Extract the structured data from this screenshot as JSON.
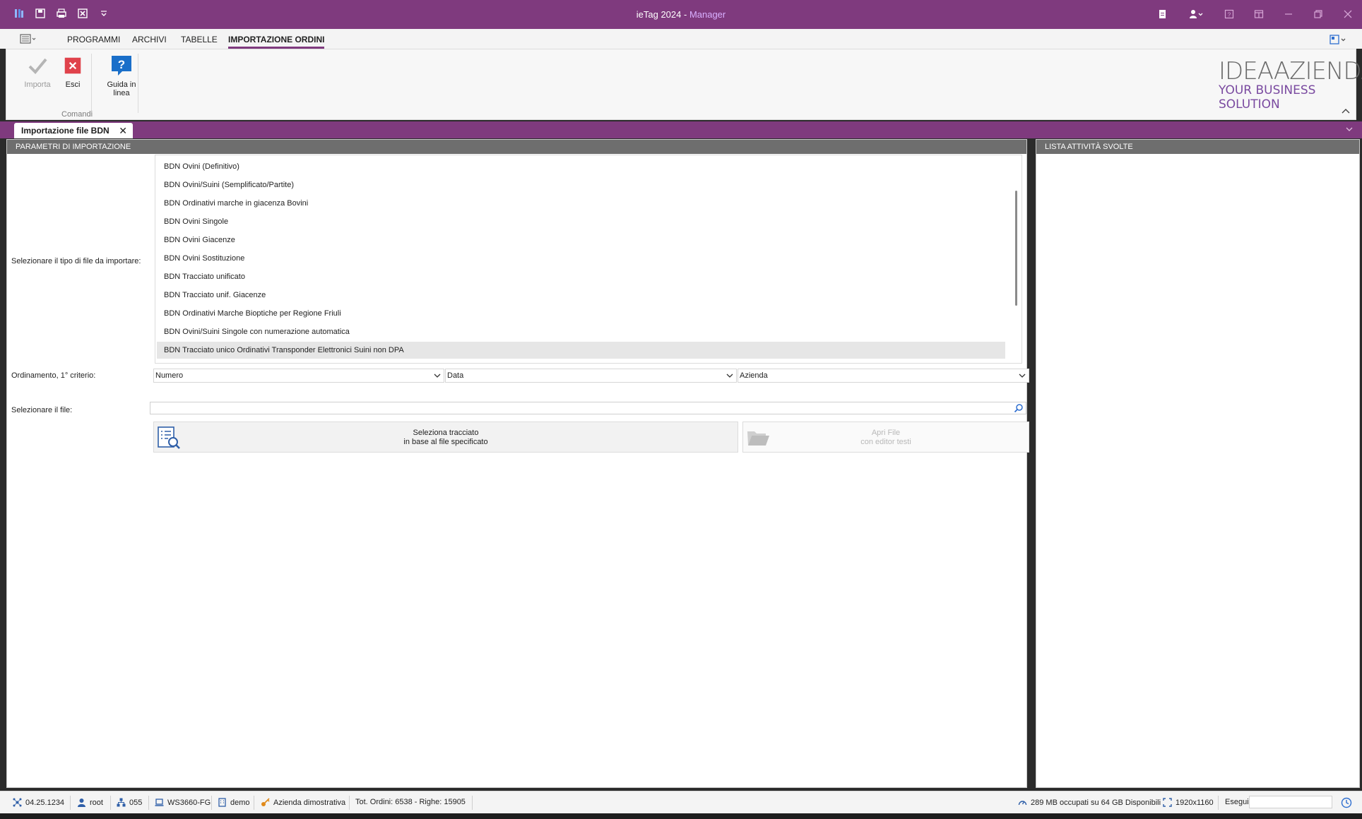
{
  "window": {
    "title_app": "ieTag 2024",
    "title_sep": " - ",
    "title_role": "Manager"
  },
  "ribbon_tabs": [
    "PROGRAMMI",
    "ARCHIVI",
    "TABELLE",
    "IMPORTAZIONE ORDINI"
  ],
  "ribbon": {
    "import_label": "Importa",
    "exit_label": "Esci",
    "help_label_1": "Guida in",
    "help_label_2": "linea",
    "group_label": "Comandi",
    "logo_line1": "IDEAAZIENDA",
    "logo_line2": "YOUR BUSINESS SOLUTION"
  },
  "doc_tab": {
    "label": "Importazione file BDN",
    "close": "✕"
  },
  "left_panel": {
    "header": "PARAMETRI DI IMPORTAZIONE",
    "file_type_label": "Selezionare il tipo di file da importare:",
    "file_types": [
      "BDN Ovini (Definitivo)",
      "BDN Ovini/Suini (Semplificato/Partite)",
      "BDN Ordinativi marche in giacenza Bovini",
      "BDN Ovini Singole",
      "BDN Ovini Giacenze",
      "BDN Ovini Sostituzione",
      "BDN Tracciato unificato",
      "BDN Tracciato unif. Giacenze",
      "BDN Ordinativi Marche Bioptiche per Regione Friuli",
      "BDN Ovini/Suini Singole con numerazione automatica",
      "BDN Tracciato unico Ordinativi Transponder Elettronici Suini non DPA"
    ],
    "selected_index": 10,
    "sort_label": "Ordinamento, 1° criterio:",
    "sort_values": [
      "Numero",
      "Data",
      "Azienda"
    ],
    "file_label": "Selezionare il file:",
    "file_value": "",
    "btn_select_1": "Seleziona tracciato",
    "btn_select_2": "in base al file specificato",
    "btn_open_1": "Apri File",
    "btn_open_2": "con editor testi"
  },
  "right_panel": {
    "header": "LISTA ATTIVITÀ SVOLTE"
  },
  "status": {
    "version": "04.25.1234",
    "user": "root",
    "code": "055",
    "workstation": "WS3660-FG",
    "db": "demo",
    "company": "Azienda dimostrativa",
    "orders": "Tot. Ordini: 6538 - Righe: 15905",
    "disk": "289 MB occupati su 64 GB Disponibili",
    "resolution": "1920x1160",
    "exec_label": "Esegui"
  },
  "colors": {
    "accent": "#7f3a7e",
    "panel_header": "#6e6e6e",
    "help_blue": "#1a6fc9",
    "exit_red": "#e0424b"
  }
}
